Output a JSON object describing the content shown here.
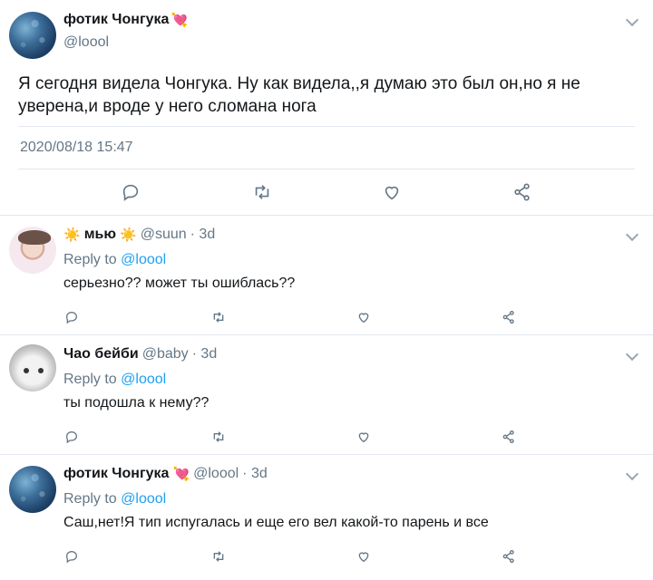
{
  "main_tweet": {
    "display_name": "фотик Чонгука",
    "name_emoji": "💘",
    "handle": "@loool",
    "text": "Я сегодня видела Чонгука. Ну как видела,,я думаю это был он,но я не уверена,и вроде у него сломана нога",
    "timestamp": "2020/08/18 15:47"
  },
  "reply_prefix": "Reply to",
  "replies": [
    {
      "display_name": "мью",
      "name_emoji_left": "☀️",
      "name_emoji_right": "☀️",
      "handle": "@suun",
      "age": "· 3d",
      "reply_to": "@loool",
      "text": "серьезно?? может ты ошиблась??"
    },
    {
      "display_name": "Чао бейби",
      "handle": "@baby",
      "age": "· 3d",
      "reply_to": "@loool",
      "text": "ты подошла к нему??"
    },
    {
      "display_name": "фотик Чонгука",
      "name_emoji": "💘",
      "handle": "@loool",
      "age": "· 3d",
      "reply_to": "@loool",
      "text": "Саш,нет!Я тип испугалась и еще его вел какой-то парень и  все"
    }
  ],
  "icons": [
    "reply-icon",
    "retweet-icon",
    "like-icon",
    "share-icon",
    "chevron-down-icon"
  ],
  "colors": {
    "link": "#1da1f2",
    "muted": "#657786",
    "text": "#14171a",
    "divider": "#e1e8ed"
  }
}
